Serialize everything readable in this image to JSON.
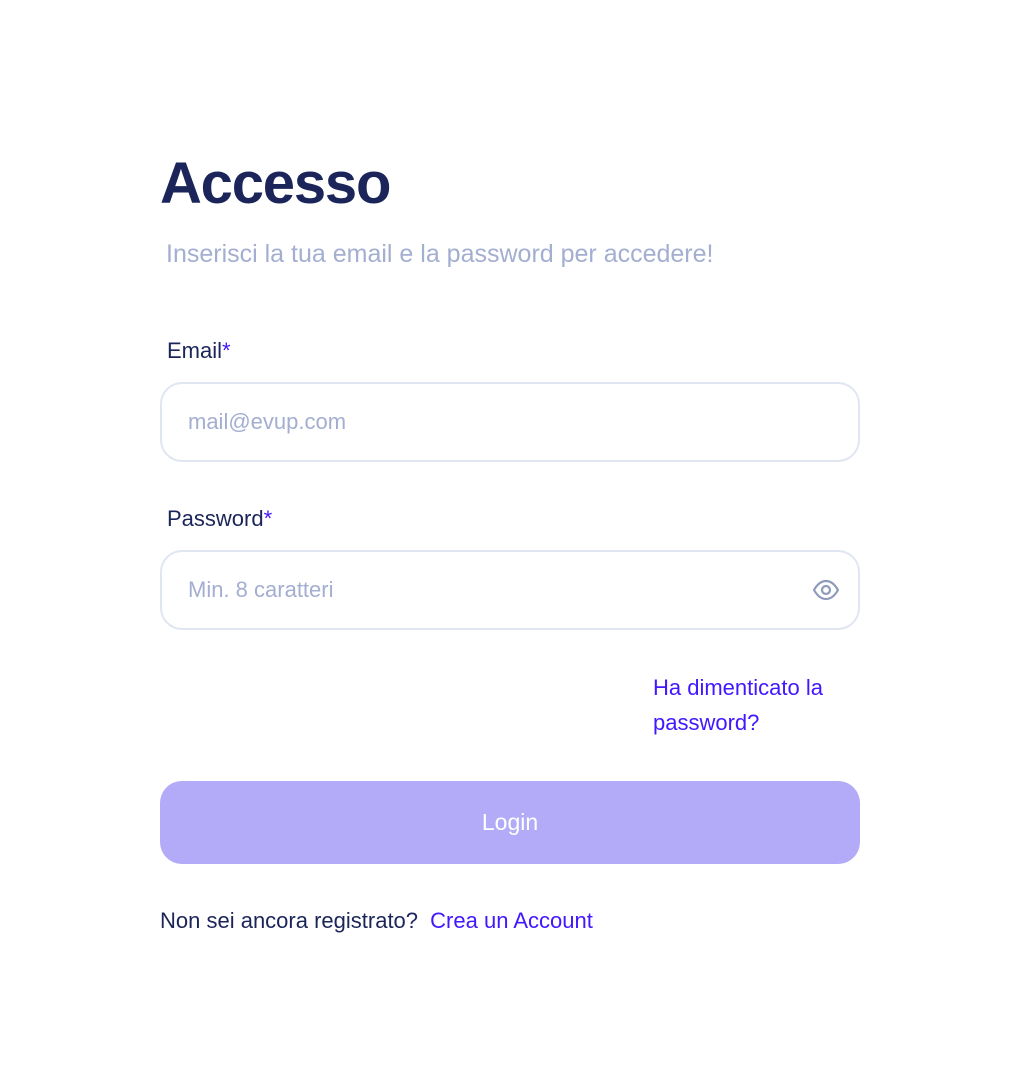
{
  "header": {
    "title": "Accesso",
    "subtitle": "Inserisci la tua email e la password per accedere!"
  },
  "email": {
    "label": "Email",
    "required_mark": "*",
    "placeholder": "mail@evup.com",
    "value": ""
  },
  "password": {
    "label": "Password",
    "required_mark": "*",
    "placeholder": "Min. 8 caratteri",
    "value": "",
    "toggle_icon": "eye-icon"
  },
  "forgot_link": "Ha dimenticato la password?",
  "login_button": "Login",
  "signup": {
    "prompt": "Non sei ancora registrato?",
    "link": "Crea un Account"
  },
  "colors": {
    "heading": "#1b2559",
    "muted": "#a3aed0",
    "accent": "#4318ff",
    "button_disabled": "#b3abf7",
    "input_border": "#e0e5f2"
  }
}
